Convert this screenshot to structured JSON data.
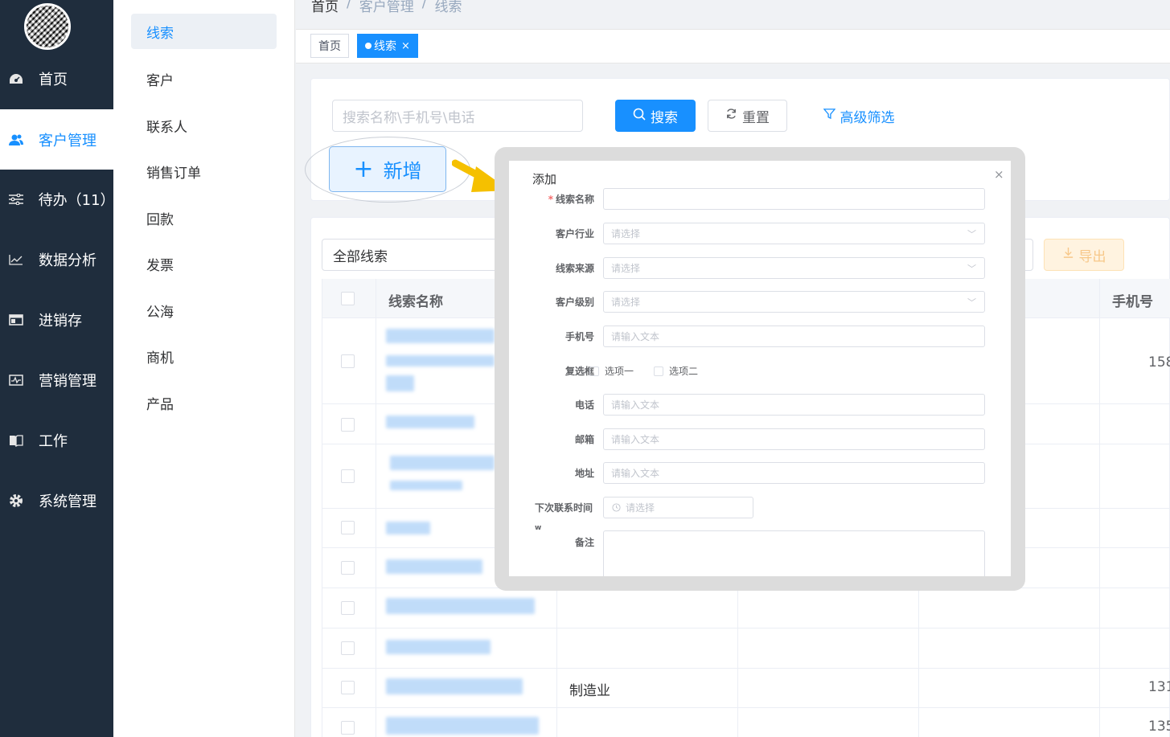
{
  "sidebar": {
    "items": [
      {
        "label": "首页",
        "icon": "dashboard-icon"
      },
      {
        "label": "客户管理",
        "icon": "users-icon"
      },
      {
        "label": "待办（11）",
        "icon": "sliders-icon"
      },
      {
        "label": "数据分析",
        "icon": "line-chart-icon"
      },
      {
        "label": "进销存",
        "icon": "window-icon"
      },
      {
        "label": "营销管理",
        "icon": "pulse-icon"
      },
      {
        "label": "工作",
        "icon": "book-icon"
      },
      {
        "label": "系统管理",
        "icon": "gear-icon"
      }
    ]
  },
  "submenu": {
    "items": [
      "线索",
      "客户",
      "联系人",
      "销售订单",
      "回款",
      "发票",
      "公海",
      "商机",
      "产品"
    ]
  },
  "breadcrumb": {
    "home": "首页",
    "sep": "/",
    "parent": "客户管理",
    "current": "线索"
  },
  "tags": {
    "home": "首页",
    "active": "线索",
    "close": "×"
  },
  "filter": {
    "search_placeholder": "搜索名称\\手机号\\电话",
    "search_label": "搜索",
    "reset_label": "重置",
    "advanced_label": "高级筛选",
    "add_label": "新增"
  },
  "table": {
    "scope": "全部线索",
    "export_label": "导出",
    "headers": {
      "name": "线索名称",
      "phone": "手机号"
    },
    "rows": [
      {
        "industry": "",
        "phone": "158"
      },
      {
        "industry": "",
        "phone": ""
      },
      {
        "industry": "",
        "phone": ""
      },
      {
        "industry": "",
        "phone": ""
      },
      {
        "industry": "",
        "phone": ""
      },
      {
        "industry": "",
        "phone": ""
      },
      {
        "industry": "",
        "phone": ""
      },
      {
        "industry": "制造业",
        "phone": "131"
      },
      {
        "industry": "",
        "phone": "135"
      }
    ]
  },
  "modal": {
    "title": "添加",
    "close": "×",
    "required_mark": "*",
    "fields": {
      "name": {
        "label": "线索名称"
      },
      "industry": {
        "label": "客户行业",
        "placeholder": "请选择"
      },
      "source": {
        "label": "线索来源",
        "placeholder": "请选择"
      },
      "level": {
        "label": "客户级别",
        "placeholder": "请选择"
      },
      "mobile": {
        "label": "手机号",
        "placeholder": "请输入文本"
      },
      "checkbox": {
        "label": "复选框",
        "option1": "选项一",
        "option2": "选项二"
      },
      "phone": {
        "label": "电话",
        "placeholder": "请输入文本"
      },
      "email": {
        "label": "邮箱",
        "placeholder": "请输入文本"
      },
      "address": {
        "label": "地址",
        "placeholder": "请输入文本"
      },
      "next_contact": {
        "label": "下次联系时间",
        "placeholder": "请选择"
      },
      "remark": {
        "label": "备注"
      }
    },
    "stray_mark": "w"
  },
  "colors": {
    "primary": "#1890ff",
    "sidebar_bg": "#1f2d3d",
    "arrow": "#f5c000"
  }
}
